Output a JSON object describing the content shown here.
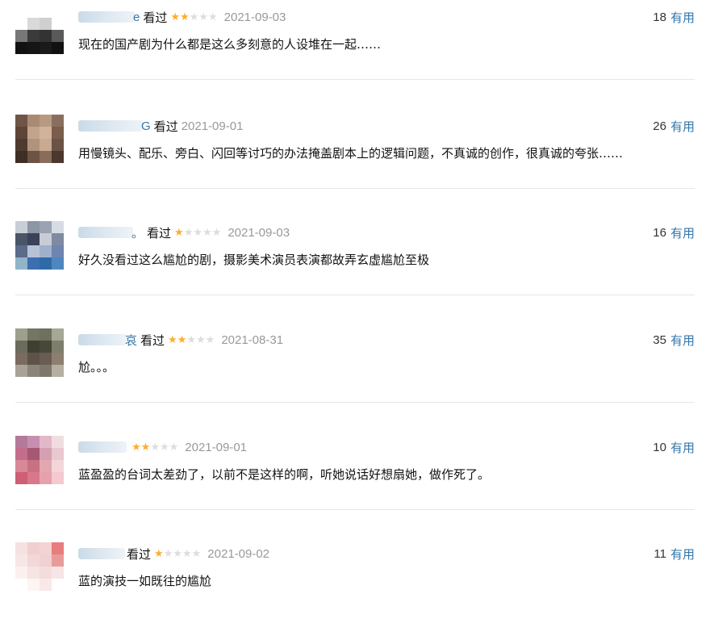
{
  "comments": [
    {
      "name_tail": "e",
      "watched": "看过",
      "rating": 2,
      "time": "2021-09-03",
      "votes": "18",
      "useful": "有用",
      "text": "现在的国产剧为什么都是这么多刻意的人设堆在一起……",
      "avatar_colors": [
        "#ffffff",
        "#ffffff",
        "#ffffff",
        "#ffffff",
        "#ffffff",
        "#d9d9d9",
        "#cfcfcf",
        "#ffffff",
        "#777777",
        "#3a3a3a",
        "#333333",
        "#5a5a5a",
        "#111111",
        "#151515",
        "#1a1a1a",
        "#111111"
      ]
    },
    {
      "name_tail": "G",
      "watched": "看过",
      "rating": 0,
      "time": "2021-09-01",
      "votes": "26",
      "useful": "有用",
      "text": "用慢镜头、配乐、旁白、闪回等讨巧的办法掩盖剧本上的逻辑问题，不真诚的创作，很真诚的夸张……",
      "avatar_colors": [
        "#6e5546",
        "#a98b74",
        "#b89a82",
        "#8a6f5e",
        "#5d4538",
        "#c2a48b",
        "#d1b39b",
        "#7a5d4c",
        "#4f3a2f",
        "#b0937c",
        "#c8aa92",
        "#6b5244",
        "#3e2e25",
        "#6d5345",
        "#8a6c5a",
        "#4a372d"
      ]
    },
    {
      "name_tail": "。",
      "watched": "看过",
      "rating": 1,
      "time": "2021-09-03",
      "votes": "16",
      "useful": "有用",
      "text": "好久没看过这么尴尬的剧，摄影美术演员表演都故弄玄虚尴尬至极",
      "avatar_colors": [
        "#c9ced6",
        "#8d96a6",
        "#9aa3b2",
        "#d7dbe2",
        "#4b5568",
        "#3a4257",
        "#c8ccd6",
        "#7f8aa0",
        "#5b6b8a",
        "#b8c2d6",
        "#9fb0cc",
        "#6d85b0",
        "#90b4c8",
        "#3b6fb0",
        "#2f6aa8",
        "#4f86c0"
      ]
    },
    {
      "name_tail": "哀",
      "watched": "看过",
      "rating": 2,
      "time": "2021-08-31",
      "votes": "35",
      "useful": "有用",
      "text": "尬。。。",
      "avatar_colors": [
        "#9ea08e",
        "#747662",
        "#6f705e",
        "#a6a897",
        "#6b6c5b",
        "#3f4034",
        "#474838",
        "#7d7e6c",
        "#7a6a5f",
        "#5e5249",
        "#6a5c52",
        "#8d7e71",
        "#a8a396",
        "#8b8579",
        "#7e776b",
        "#b5afa2"
      ]
    },
    {
      "name_tail": "",
      "watched": "",
      "rating": 2,
      "time": "2021-09-01",
      "votes": "10",
      "useful": "有用",
      "text": "蓝盈盈的台词太差劲了，以前不是这样的啊，听她说话好想扇她，做作死了。",
      "avatar_colors": [
        "#b47a9a",
        "#c68fb2",
        "#e2b9c9",
        "#f0dde0",
        "#c46d8a",
        "#a55873",
        "#d4a0b1",
        "#e9c8cf",
        "#d88896",
        "#c77183",
        "#e2a7b0",
        "#f2d6da",
        "#ce5f74",
        "#d8788a",
        "#e7a1ac",
        "#f4c9cf"
      ]
    },
    {
      "name_tail": "",
      "watched": "看过",
      "rating": 1,
      "time": "2021-09-02",
      "votes": "11",
      "useful": "有用",
      "text": "蓝的演技一如既往的尴尬",
      "avatar_colors": [
        "#f6e1e1",
        "#f0cfcf",
        "#f3d3d3",
        "#e87d7d",
        "#f7e6e6",
        "#f2d8d8",
        "#f0d0d0",
        "#e99a9a",
        "#fbf0f0",
        "#f6e3e3",
        "#f4dcdc",
        "#f7e4e4",
        "#ffffff",
        "#fdf4f4",
        "#f8e8e8",
        "#ffffff"
      ]
    }
  ]
}
